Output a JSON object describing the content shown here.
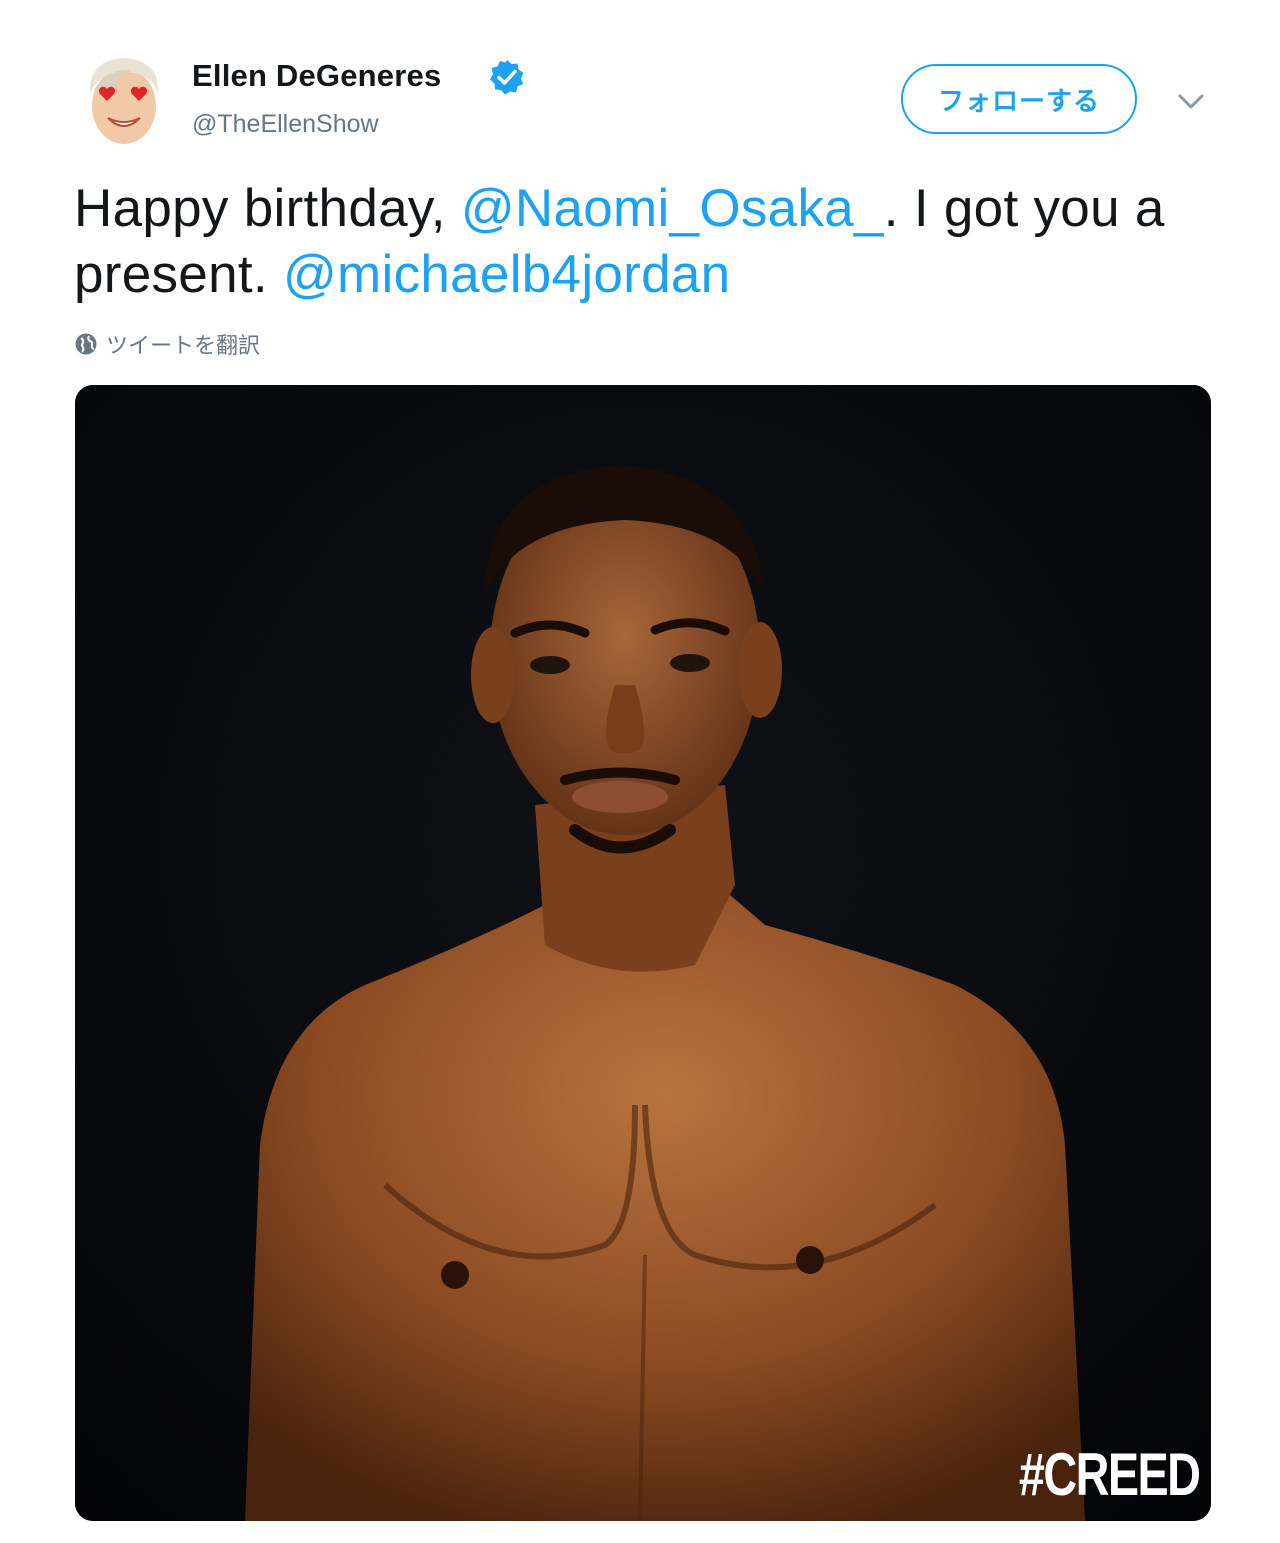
{
  "author": {
    "display_name": "Ellen DeGeneres",
    "screen_name": "@TheEllenShow",
    "verified": true,
    "avatar_icon": "heart-eyes-avatar-icon"
  },
  "header": {
    "follow_label": "フォローする",
    "menu_icon": "chevron-down-icon"
  },
  "tweet": {
    "text_1": "Happy birthday, ",
    "mention_1": "@Naomi_Osaka_",
    "text_2": ". I got you a present. ",
    "mention_2": "@michaelb4jordan",
    "translate_label": "ツイートを翻訳"
  },
  "media": {
    "watermark": "#CREED"
  },
  "colors": {
    "accent": "#1da1f2",
    "secondary_text": "#657786",
    "primary_text": "#14171a",
    "media_background": "#06070a"
  }
}
